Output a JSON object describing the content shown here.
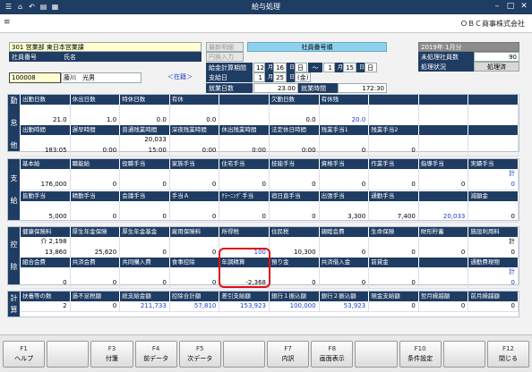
{
  "window": {
    "title": "給与処理",
    "company": "ＯＢＣ商事株式会社"
  },
  "toolbar_icons": [
    "menu-icon",
    "home-icon",
    "back-icon",
    "doc-icon",
    "grid-icon",
    "minimize-icon",
    "maximize-icon",
    "close-icon"
  ],
  "header": {
    "dept": "301 営業部 東日本営業課",
    "emp_no_label": "社員番号",
    "name_label": "氏名",
    "emp_no": "100008",
    "emp_name": "藤川　光男",
    "status_link": "＜在籍＞",
    "btn_meisai": "最新明細",
    "btn_input": "円換入力",
    "emp_no_header": "社員番号順",
    "period_label": "給金計算期間",
    "period": {
      "m1": "12",
      "d1": "16",
      "dw1": "日",
      "sep": "〜",
      "m2": "1",
      "d2": "15",
      "dw2": "日"
    },
    "pay_label": "支給日",
    "pay": {
      "m": "1",
      "d": "25",
      "dw": "(金)"
    },
    "workdays_label": "就業日数",
    "workdays": "23.00",
    "workhours_label": "就業時間",
    "workhours": "172:30",
    "year": "2019年 1月分",
    "unproc_label": "未処理社員数",
    "unproc": "90",
    "status_label": "処理状況",
    "status": "処理済"
  },
  "attendance": {
    "side": [
      "勤",
      "怠",
      "他"
    ],
    "r1": {
      "headers": [
        "出勤日数",
        "休出日数",
        "特休日数",
        "有休",
        "",
        "欠勤日数",
        "有休残",
        "",
        "",
        ""
      ],
      "values": [
        "21.0",
        "1.0",
        "0.0",
        "0.0",
        "",
        "0.0",
        "20.0",
        "",
        "",
        ""
      ]
    },
    "r2": {
      "headers": [
        "出勤時間",
        "遅早時間",
        "普通残業時間",
        "深夜残業時間",
        "休出残業時間",
        "法定休日時間",
        "残業手当1",
        "残業手当2",
        "",
        ""
      ],
      "values": [
        "183:05",
        "0:00",
        "20,033\n15:00",
        "0:00",
        "0:00",
        "0:00",
        "0",
        "0",
        "",
        ""
      ]
    }
  },
  "payment": {
    "side": [
      "支",
      "給"
    ],
    "r1": {
      "headers": [
        "基本給",
        "職能給",
        "役職手当",
        "家族手当",
        "住宅手当",
        "技能手当",
        "資格手当",
        "作業手当",
        "指導手当",
        "実績手当"
      ],
      "values": [
        "176,000",
        "0",
        "0",
        "0",
        "0",
        "0",
        "0",
        "0",
        "0",
        "計\n0"
      ]
    },
    "r2": {
      "headers": [
        "皆勤手当",
        "精勤手当",
        "会議手当",
        "手当Ａ",
        "ｸﾗｰﾆﾝｸﾞ手当",
        "宿日直手当",
        "出張手当",
        "通勤手当",
        "",
        "減額金"
      ],
      "values": [
        "5,000",
        "0",
        "0",
        "0",
        "0",
        "0",
        "3,300",
        "7,400",
        "20,033",
        "0"
      ]
    }
  },
  "deduction": {
    "side": [
      "控",
      "除"
    ],
    "r1": {
      "headers": [
        "健康保険料",
        "厚生年金保険",
        "厚生年金基金",
        "雇用保険料",
        "所得税",
        "住民税",
        "親睦会費",
        "生命保険",
        "財形貯蓄",
        "施設利用料"
      ],
      "values": [
        "介 2,198\n13,860",
        "25,620",
        "0",
        "0",
        "100",
        "10,300",
        "0",
        "0",
        "0",
        "計\n0"
      ]
    },
    "r2": {
      "headers": [
        "組合会費",
        "共済会費",
        "共同購入費",
        "食事控除",
        "年調精算",
        "預り金",
        "共済借入金",
        "前貸金",
        "",
        "通勤費現物"
      ],
      "values": [
        "0",
        "0",
        "0",
        "0",
        "-2,368",
        "0",
        "0",
        "0",
        "",
        "計\n0"
      ]
    }
  },
  "totals": {
    "side": [
      "計",
      "算"
    ],
    "headers": [
      "扶養等の数",
      "過不足税額",
      "総支給金額",
      "控除合計額",
      "差引支給額",
      "銀行１振込額",
      "銀行２振込額",
      "現金支給額",
      "翌月繰越額",
      "前月繰越額"
    ],
    "values": [
      "2",
      "0",
      "211,733",
      "57,810",
      "153,923",
      "100,000",
      "53,923",
      "0",
      "0",
      "0"
    ]
  },
  "fkeys": [
    {
      "n": "F1",
      "l": "ヘルプ"
    },
    {
      "n": "",
      "l": ""
    },
    {
      "n": "F3",
      "l": "付箋"
    },
    {
      "n": "F4",
      "l": "前データ"
    },
    {
      "n": "F5",
      "l": "次データ"
    },
    {
      "n": "",
      "l": ""
    },
    {
      "n": "F7",
      "l": "内訳"
    },
    {
      "n": "F8",
      "l": "画面表示"
    },
    {
      "n": "",
      "l": ""
    },
    {
      "n": "F10",
      "l": "条件設定"
    },
    {
      "n": "",
      "l": ""
    },
    {
      "n": "F12",
      "l": "閉じる"
    }
  ]
}
